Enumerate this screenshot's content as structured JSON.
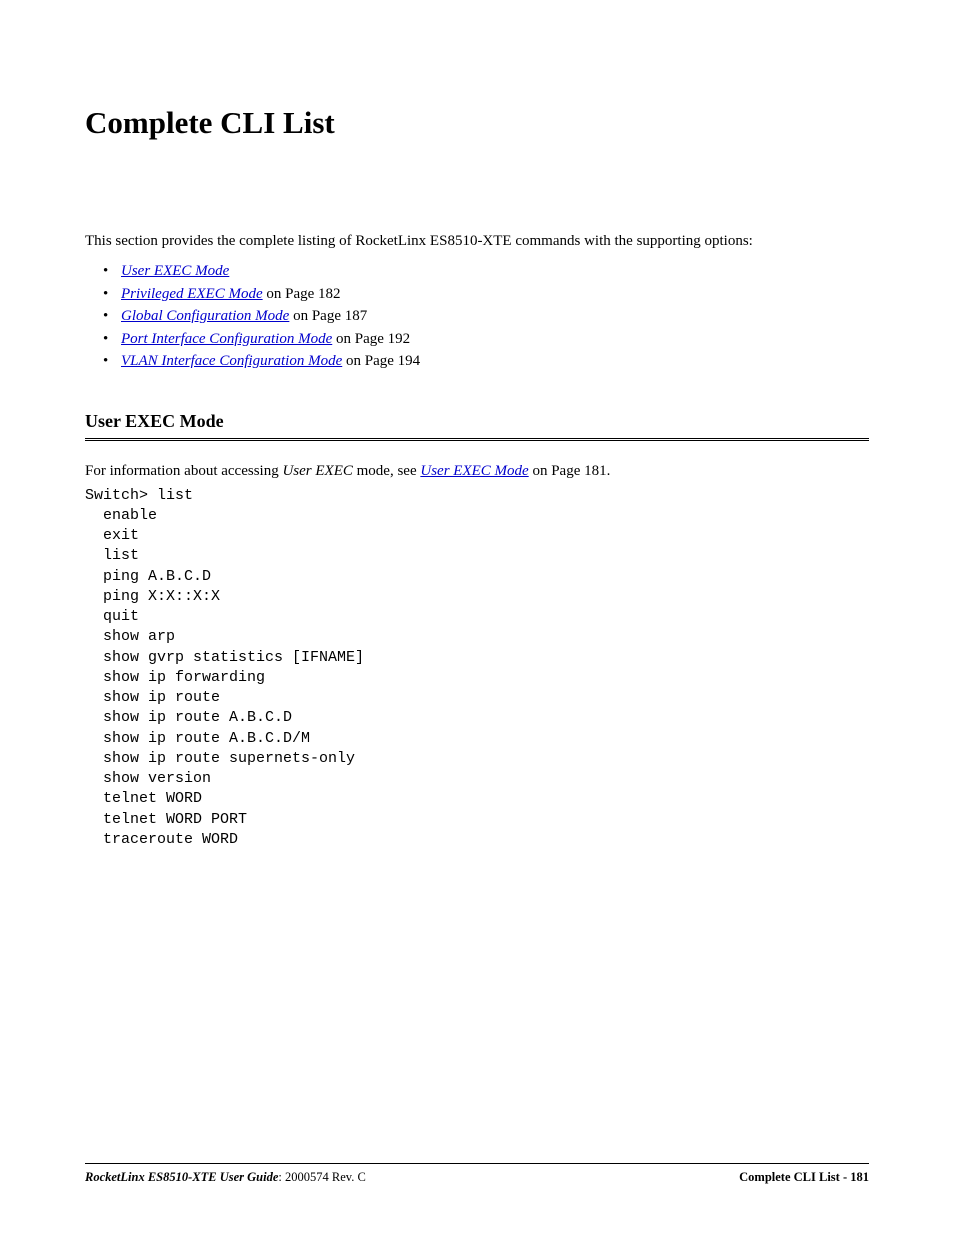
{
  "page": {
    "title": "Complete CLI List",
    "intro": "This section provides the complete listing of RocketLinx ES8510-XTE commands with the supporting options:"
  },
  "toc": [
    {
      "link": "User EXEC Mode",
      "suffix": ""
    },
    {
      "link": "Privileged EXEC Mode",
      "suffix": " on Page 182"
    },
    {
      "link": "Global Configuration Mode",
      "suffix": " on Page 187"
    },
    {
      "link": "Port Interface Configuration Mode",
      "suffix": " on Page 192"
    },
    {
      "link": "VLAN Interface Configuration Mode",
      "suffix": " on Page 194"
    }
  ],
  "section": {
    "heading": "User EXEC Mode",
    "intro_prefix": "For information about accessing ",
    "intro_italic": "User EXEC",
    "intro_mid": " mode, see ",
    "intro_link": "User EXEC Mode",
    "intro_suffix": " on Page 181."
  },
  "code": "Switch> list\n  enable\n  exit\n  list\n  ping A.B.C.D\n  ping X:X::X:X\n  quit\n  show arp\n  show gvrp statistics [IFNAME]\n  show ip forwarding\n  show ip route\n  show ip route A.B.C.D\n  show ip route A.B.C.D/M\n  show ip route supernets-only\n  show version\n  telnet WORD\n  telnet WORD PORT\n  traceroute WORD",
  "footer": {
    "doc_title": "RocketLinx ES8510-XTE User Guide",
    "doc_rev": ": 2000574 Rev. C",
    "right": "Complete CLI List - 181"
  }
}
